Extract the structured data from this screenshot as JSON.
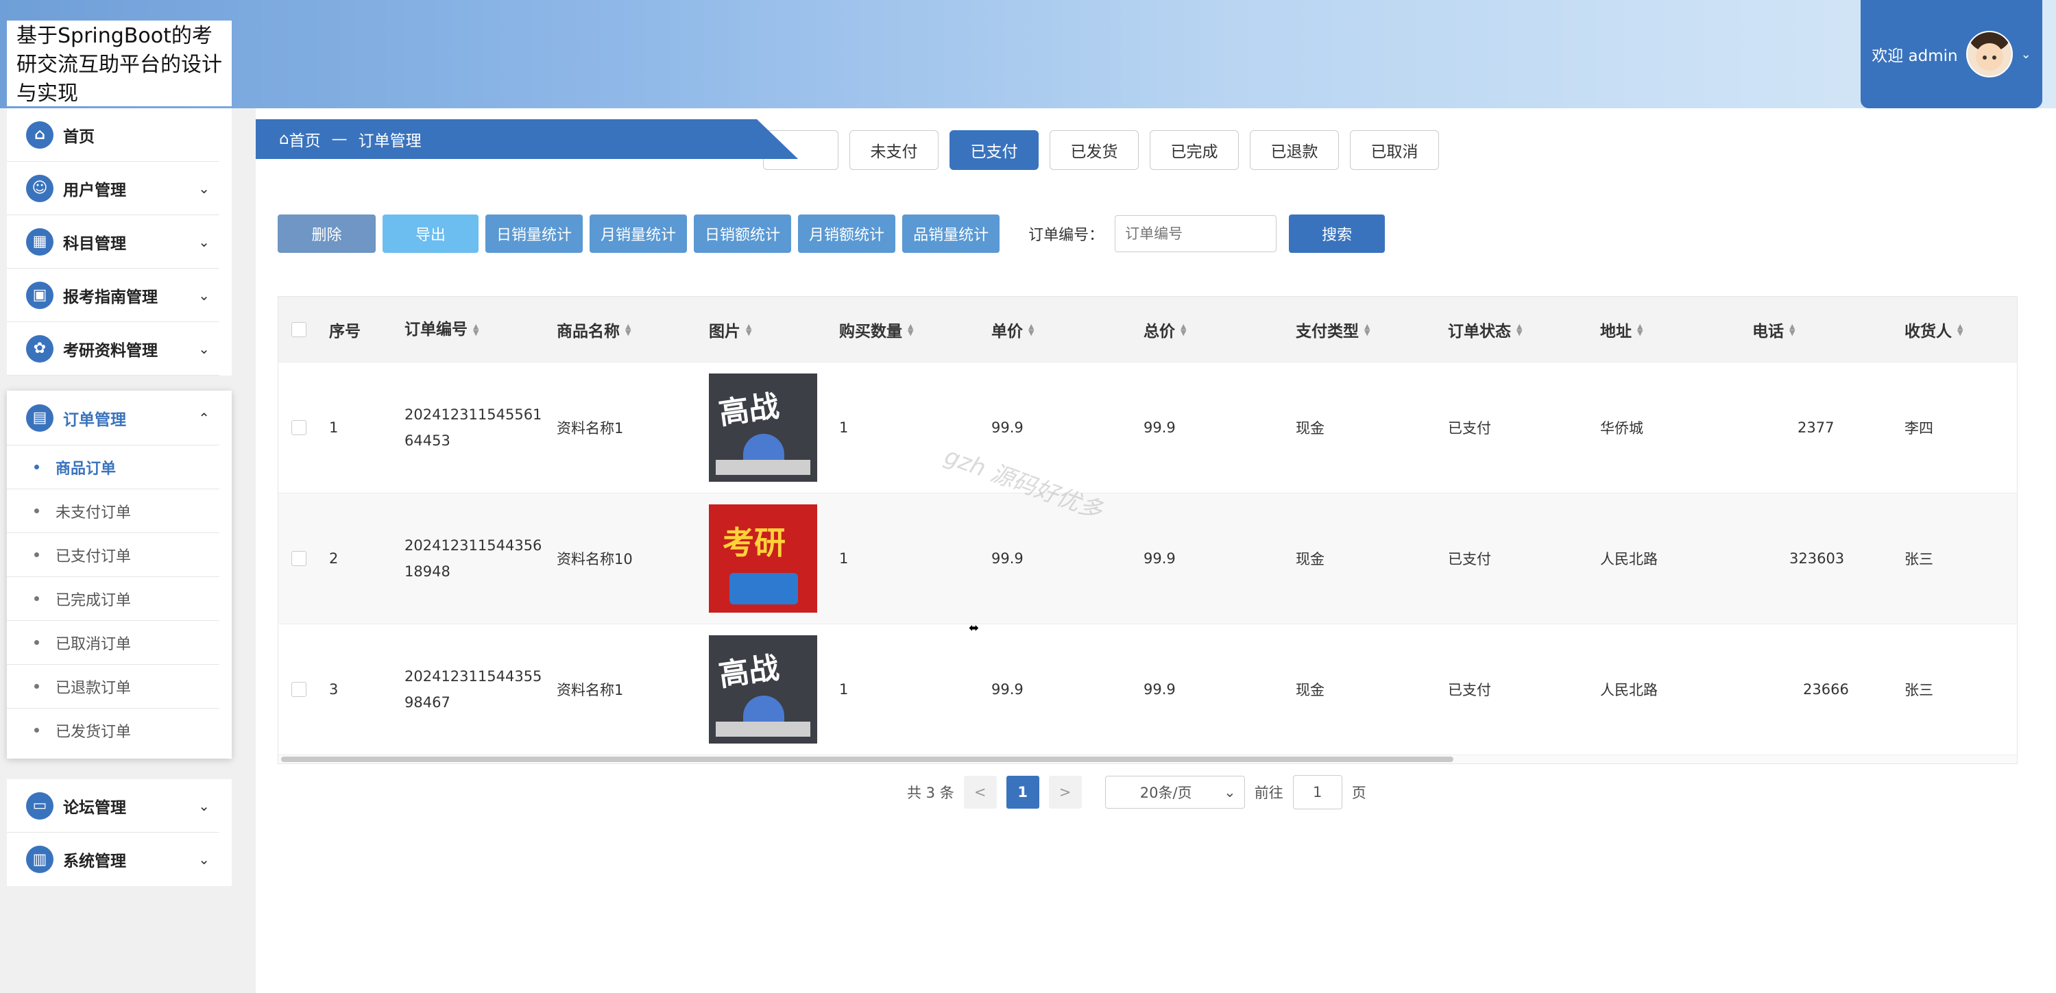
{
  "app": {
    "title": "基于SpringBoot的考研交流互助平台的设计与实现"
  },
  "header": {
    "welcome": "欢迎 admin",
    "avatar_icon": "user-avatar",
    "dropdown_icon": "chevron-down-icon"
  },
  "sidebar": {
    "items": [
      {
        "label": "首页",
        "icon": "home-icon",
        "glyph": "⌂"
      },
      {
        "label": "用户管理",
        "icon": "user-icon",
        "glyph": "☺",
        "arrow": "⌄"
      },
      {
        "label": "科目管理",
        "icon": "grid-icon",
        "glyph": "▦",
        "arrow": "⌄"
      },
      {
        "label": "报考指南管理",
        "icon": "bag-icon",
        "glyph": "▣",
        "arrow": "⌄"
      },
      {
        "label": "考研资料管理",
        "icon": "cluster-icon",
        "glyph": "✿",
        "arrow": "⌄"
      }
    ],
    "open": {
      "label": "订单管理",
      "icon": "layout-icon",
      "glyph": "▤",
      "arrow": "⌃",
      "children": [
        "商品订单",
        "未支付订单",
        "已支付订单",
        "已完成订单",
        "已取消订单",
        "已退款订单",
        "已发货订单"
      ]
    },
    "lower": [
      {
        "label": "论坛管理",
        "icon": "monitor-icon",
        "glyph": "▭",
        "arrow": "⌄"
      },
      {
        "label": "系统管理",
        "icon": "briefcase-icon",
        "glyph": "▥",
        "arrow": "⌄"
      }
    ]
  },
  "breadcrumb": {
    "home_icon": "⌂",
    "home": "首页",
    "sep": "—",
    "current": "订单管理"
  },
  "status_tabs": [
    "",
    "未支付",
    "已支付",
    "已发货",
    "已完成",
    "已退款",
    "已取消"
  ],
  "status_tabs_active": 2,
  "toolbar": {
    "delete": "删除",
    "export": "导出",
    "stats": [
      "日销量统计",
      "月销量统计",
      "日销额统计",
      "月销额统计",
      "品销量统计"
    ],
    "search_label": "订单编号：",
    "search_placeholder": "订单编号",
    "search_btn": "搜索"
  },
  "table": {
    "headers": [
      "序号",
      "订单编号",
      "商品名称",
      "图片",
      "购买数量",
      "单价",
      "总价",
      "支付类型",
      "订单状态",
      "地址",
      "电话",
      "收货人"
    ],
    "rows": [
      {
        "idx": "1",
        "order": "20241231154556164453",
        "name": "资料名称1",
        "qty": "1",
        "price": "99.9",
        "total": "99.9",
        "pay": "现金",
        "status": "已支付",
        "addr": "华侨城",
        "phone": "2377",
        "recv": "李四"
      },
      {
        "idx": "2",
        "order": "20241231154435618948",
        "name": "资料名称10",
        "qty": "1",
        "price": "99.9",
        "total": "99.9",
        "pay": "现金",
        "status": "已支付",
        "addr": "人民北路",
        "phone": "323603",
        "recv": "张三"
      },
      {
        "idx": "3",
        "order": "20241231154435598467",
        "name": "资料名称1",
        "qty": "1",
        "price": "99.9",
        "total": "99.9",
        "pay": "现金",
        "status": "已支付",
        "addr": "人民北路",
        "phone": "23666",
        "recv": "张三"
      }
    ],
    "book_a_text": "高战",
    "book_b_text": "考研"
  },
  "pagination": {
    "total": "共 3 条",
    "prev": "<",
    "current": "1",
    "next": ">",
    "page_size": "20条/页",
    "goto_label": "前往",
    "goto_value": "1",
    "page_unit": "页"
  },
  "watermark": "gzh 源码好优多"
}
